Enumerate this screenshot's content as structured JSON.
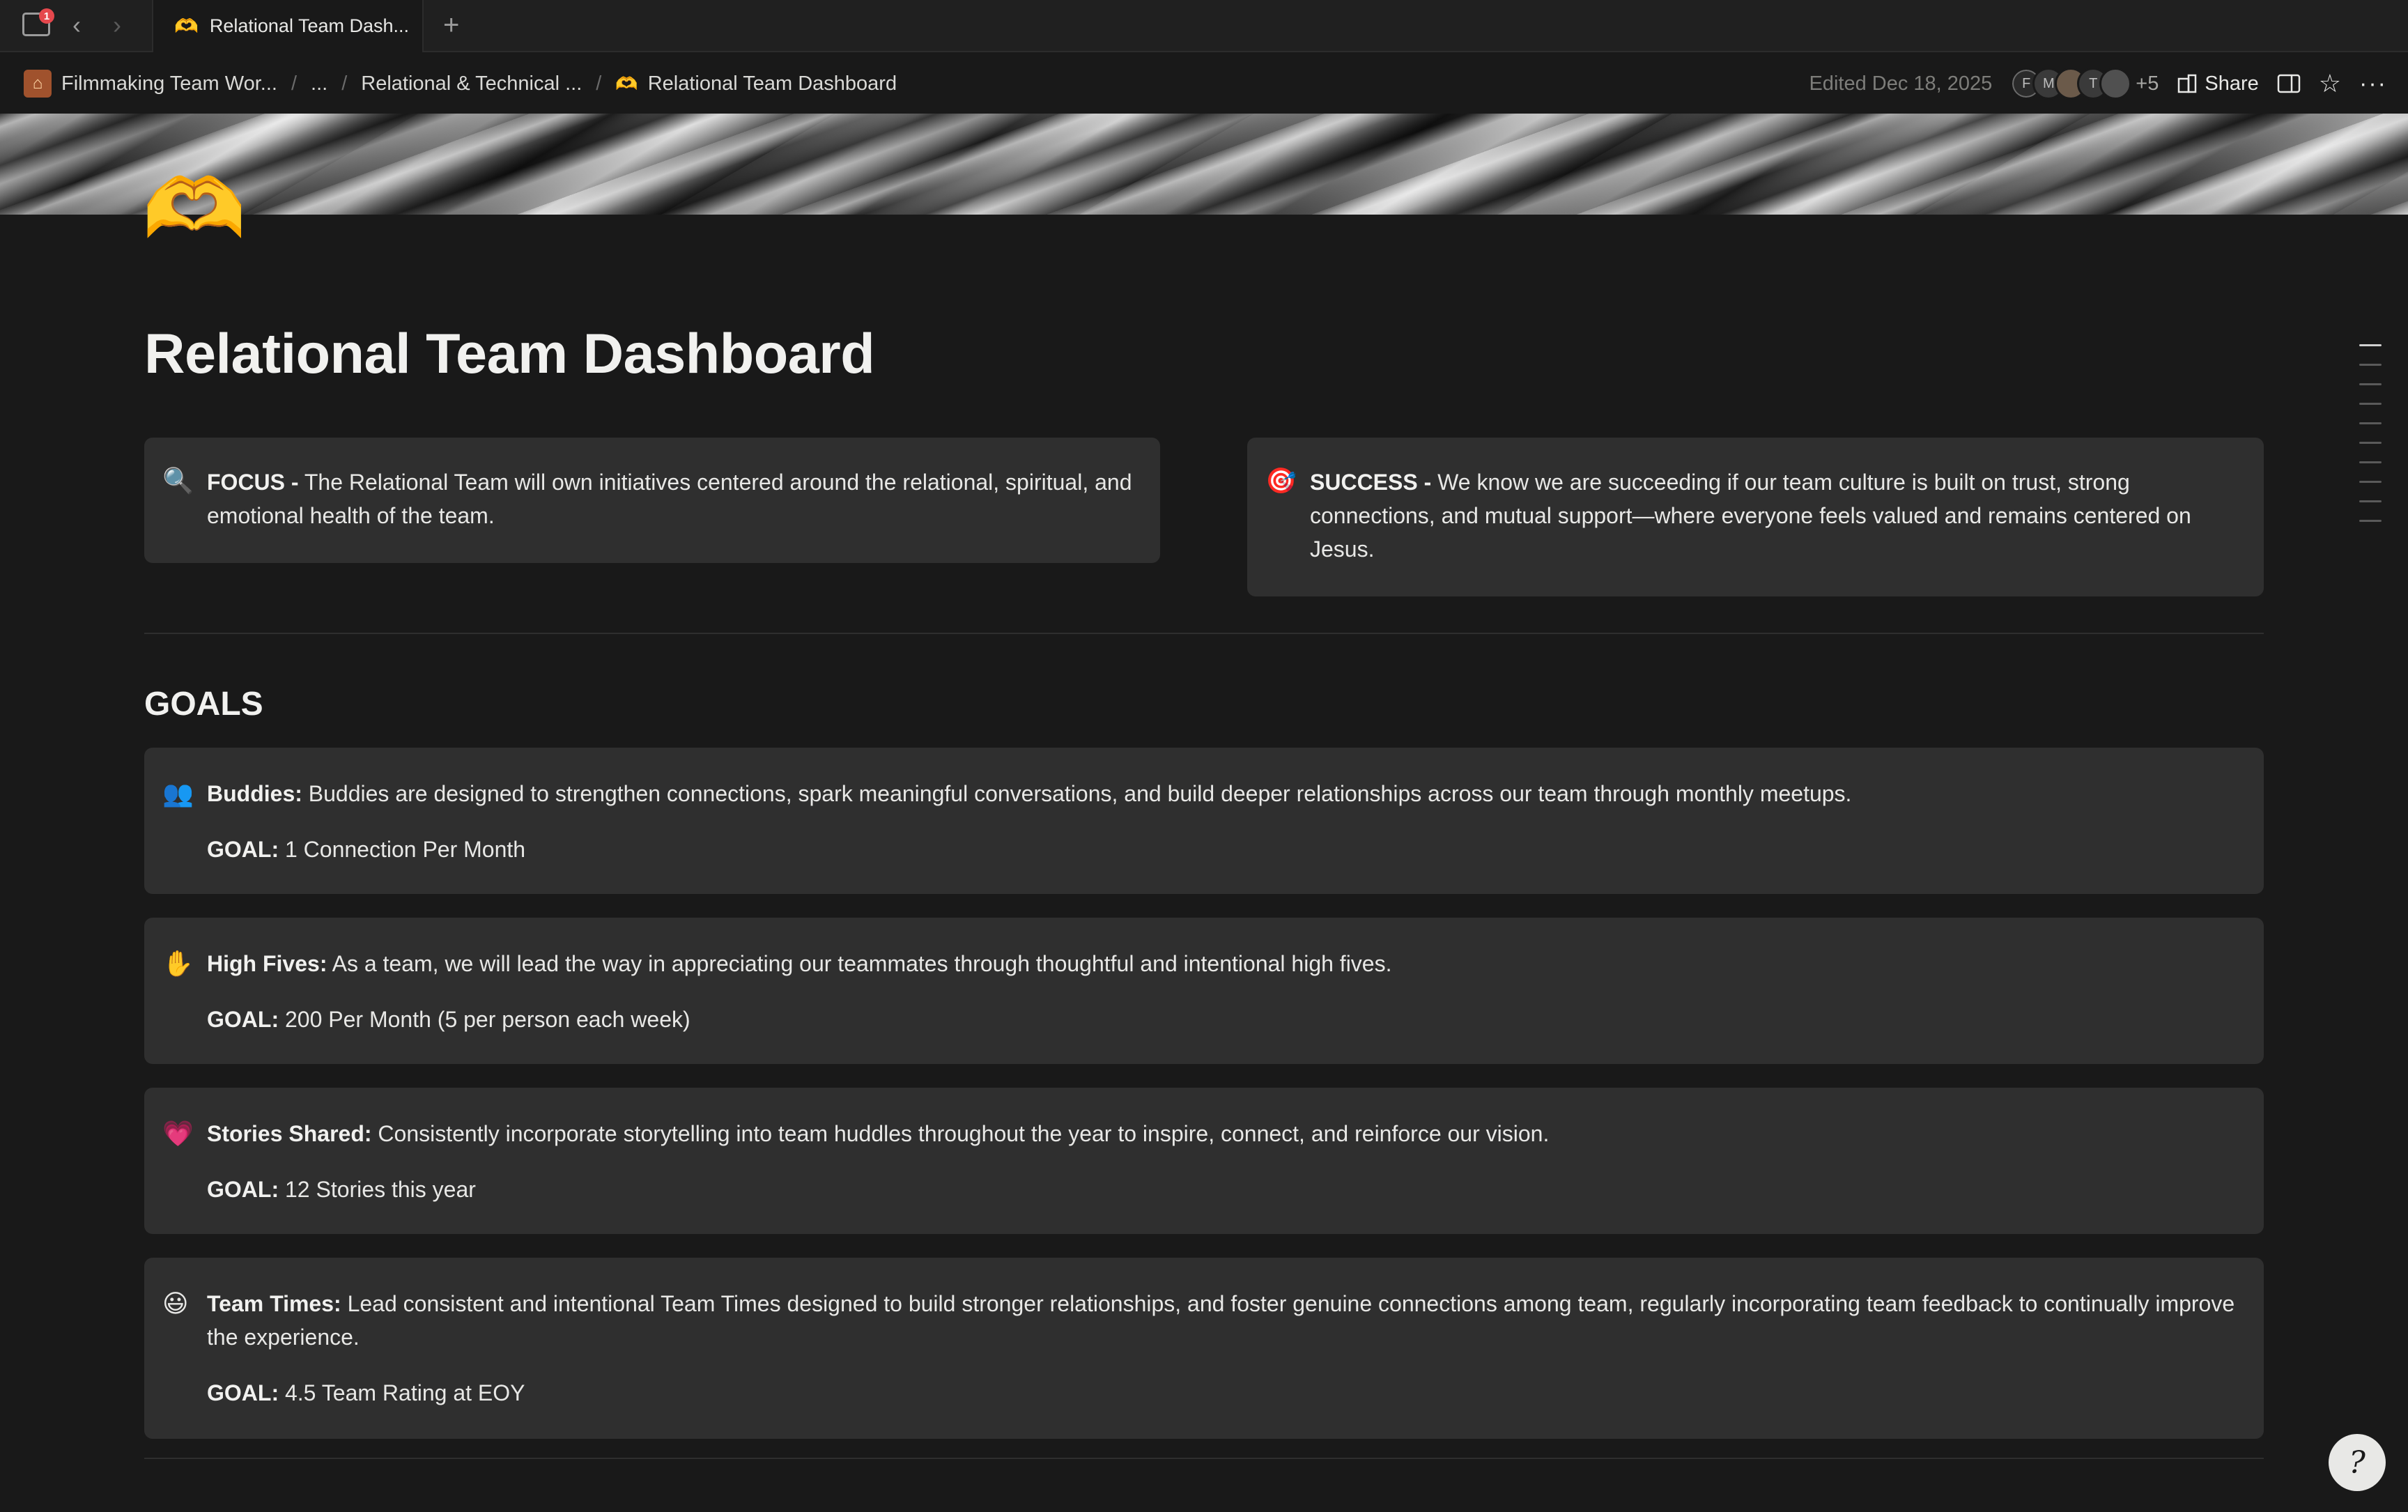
{
  "tab": {
    "title": "Relational Team Dash...",
    "badge": "1"
  },
  "breadcrumbs": [
    {
      "label": "Filmmaking Team Wor..."
    },
    {
      "label": "..."
    },
    {
      "label": "Relational & Technical ..."
    },
    {
      "label": "Relational Team Dashboard"
    }
  ],
  "header": {
    "edited": "Edited Dec 18, 2025",
    "avatars": [
      "F",
      "M",
      "",
      "T",
      ""
    ],
    "more_count": "+5",
    "share_label": "Share"
  },
  "page": {
    "title": "Relational Team Dashboard",
    "focus": {
      "icon": "magnifying-glass",
      "label": "FOCUS -",
      "text": " The Relational Team will own initiatives centered around the relational, spiritual, and emotional health of the team."
    },
    "success": {
      "icon": "direct-hit",
      "label": "SUCCESS -",
      "text": " We know we are succeeding if our team culture is built on trust, strong connections, and mutual support—where everyone feels valued and remains centered on Jesus."
    },
    "goals_heading": "GOALS",
    "goals": [
      {
        "icon": "busts-in-silhouette",
        "name": "Buddies:",
        "desc": " Buddies are designed to strengthen connections, spark meaningful conversations, and build deeper relationships across our team through monthly meetups.",
        "goal_label": "GOAL:",
        "goal_value": " 1 Connection Per Month"
      },
      {
        "icon": "raised-hand",
        "name": "High Fives:",
        "desc": " As a team, we will lead the way in appreciating our teammates through thoughtful and intentional high fives.",
        "goal_label": "GOAL:",
        "goal_value": " 200 Per Month (5 per person each week)"
      },
      {
        "icon": "growing-heart",
        "name": "Stories Shared:",
        "desc": " Consistently incorporate storytelling into team huddles throughout the year to inspire, connect, and reinforce our vision.",
        "goal_label": "GOAL:",
        "goal_value": " 12 Stories this year"
      },
      {
        "icon": "smiling-face",
        "name": "Team Times:",
        "desc": " Lead consistent and intentional Team Times designed to build stronger relationships, and foster genuine connections among team, regularly incorporating team feedback to continually improve the experience.",
        "goal_label": "GOAL:",
        "goal_value": " 4.5 Team Rating at EOY"
      }
    ]
  },
  "help_glyph": "?"
}
